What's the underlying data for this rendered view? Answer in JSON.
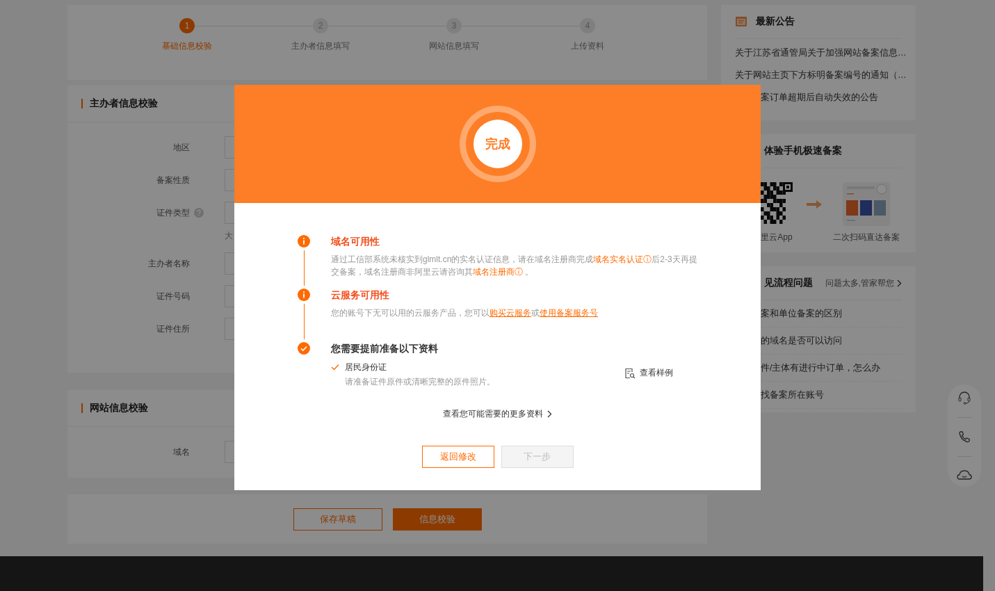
{
  "steps": [
    {
      "number": "1",
      "label": "基础信息校验",
      "selected": true
    },
    {
      "number": "2",
      "label": "主办者信息填写",
      "selected": false
    },
    {
      "number": "3",
      "label": "网站信息填写",
      "selected": false
    },
    {
      "number": "4",
      "label": "上传资料",
      "selected": false
    }
  ],
  "sections": [
    {
      "title": "主办者信息校验",
      "fields": [
        {
          "label": "地区"
        },
        {
          "label": "备案性质"
        },
        {
          "label": "证件类型",
          "help": true,
          "hint": "大"
        },
        {
          "label": "主办者名称"
        },
        {
          "label": "证件号码"
        },
        {
          "label": "证件住所"
        }
      ]
    },
    {
      "title": "网站信息校验",
      "fields": [
        {
          "label": "域名"
        }
      ]
    }
  ],
  "form_buttons": [
    {
      "label": "保存草稿",
      "kind": "secondary"
    },
    {
      "label": "信息校验",
      "kind": "primary"
    }
  ],
  "announcements": {
    "title": "最新公告",
    "items": [
      "关于江苏省通管局关于加强网站备案信息…",
      "关于网站主页下方标明备案编号的通知（…",
      "案订单超期后自动失效的公告"
    ]
  },
  "mobile_filing": {
    "title": "体验手机极速备案",
    "steps": [
      "里云App",
      "二次扫码直达备案"
    ]
  },
  "faq": {
    "title": "见流程问题",
    "more": "问题太多,管家帮您",
    "items": [
      "案和单位备案的区别",
      "的域名是否可以访问",
      "件/主体有进行中订单，怎么办",
      "找备案所在账号"
    ]
  },
  "dialog": {
    "badge": "完成",
    "checks": [
      {
        "kind": "warning",
        "title": "域名可用性",
        "text": [
          {
            "kind": "plain",
            "text": "通过工信部系统未核实到glmlt.cn的实名认证信息，请在域名注册商完成"
          },
          {
            "kind": "link",
            "text": "域名实名认证ⓘ"
          },
          {
            "kind": "plain",
            "text": "后2-3天再提交备案，域名注册商非阿里云请咨询其"
          },
          {
            "kind": "link",
            "text": "域名注册商ⓘ"
          },
          {
            "kind": "plain",
            "text": " 。"
          }
        ]
      },
      {
        "kind": "warning",
        "title": "云服务可用性",
        "text": [
          {
            "kind": "plain",
            "text": "您的账号下无可以用的云服务产品，您可以"
          },
          {
            "kind": "underline_link",
            "text": "购买云服务"
          },
          {
            "kind": "plain",
            "text": "或"
          },
          {
            "kind": "underline_link",
            "text": "使用备案服务号"
          }
        ]
      },
      {
        "kind": "done",
        "title": "您需要提前准备以下资料"
      }
    ],
    "materials": [
      {
        "name": "居民身份证",
        "note": "请准备证件原件或清晰完整的原件照片。",
        "sample": "查看样例"
      }
    ],
    "more": "查看您可能需要的更多资料",
    "buttons": [
      {
        "label": "返回修改",
        "disabled": false
      },
      {
        "label": "下一步",
        "disabled": true
      }
    ]
  }
}
